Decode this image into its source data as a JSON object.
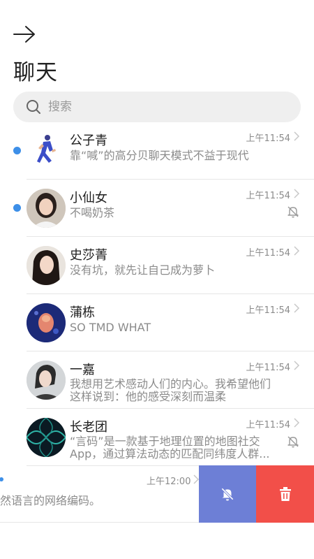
{
  "header": {
    "title": "聊天",
    "back_icon": "arrow-right-icon"
  },
  "search": {
    "placeholder": "搜索",
    "icon": "search-icon"
  },
  "colors": {
    "unread_dot": "#3d8fe8",
    "mute_action": "#6d7fd6",
    "delete_action": "#f24f49"
  },
  "chats": [
    {
      "name": "公子青",
      "preview": "靠“喊”的高分贝聊天模式不益于现代",
      "time": "上午11:54",
      "unread": true,
      "muted": false
    },
    {
      "name": "小仙女",
      "preview": "不喝奶茶",
      "time": "上午11:54",
      "unread": true,
      "muted": true
    },
    {
      "name": "史莎菁",
      "preview": "没有坑，就先让自己成为萝卜",
      "time": "上午11:54",
      "unread": false,
      "muted": false
    },
    {
      "name": "蒲栋",
      "preview": "SO TMD WHAT",
      "time": "上午11:54",
      "unread": false,
      "muted": false
    },
    {
      "name": "一嘉",
      "preview_line1": "我想用艺术感动人们的内心。我希望他们",
      "preview_line2": "这样说到：他的感受深刻而温柔",
      "time": "上午11:54",
      "unread": false,
      "muted": false
    },
    {
      "name": "长老团",
      "preview_line1": "“言码”是一款基于地理位置的地图社交",
      "preview_line2": "App，通过算法动态的匹配同纬度人群...",
      "time": "上午11:54",
      "unread": false,
      "muted": true
    }
  ],
  "swiped_chat": {
    "preview": "然语言的网络编码。",
    "time": "上午12:00",
    "actions": {
      "mute_icon": "bell-off-icon",
      "delete_icon": "trash-icon"
    }
  }
}
